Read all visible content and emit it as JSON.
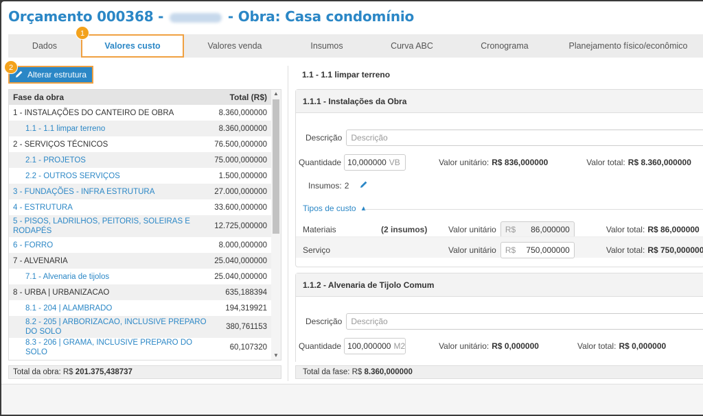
{
  "window": {
    "title_prefix": "Orçamento 000368 -",
    "title_suffix": "- Obra: Casa condomínio"
  },
  "tabs": [
    {
      "label": "Dados"
    },
    {
      "label": "Valores custo"
    },
    {
      "label": "Valores venda"
    },
    {
      "label": "Insumos"
    },
    {
      "label": "Curva ABC"
    },
    {
      "label": "Cronograma"
    },
    {
      "label": "Planejamento físico/econômico"
    }
  ],
  "badges": {
    "one": "1",
    "two": "2"
  },
  "left": {
    "alterar_label": "Alterar estrutura",
    "header": {
      "fase": "Fase da obra",
      "total": "Total (R$)"
    },
    "rows": [
      {
        "label": "1 - INSTALAÇÕES DO CANTEIRO DE OBRA",
        "value": "8.360,000000"
      },
      {
        "label": "1.1 - 1.1 limpar terreno",
        "value": "8.360,000000"
      },
      {
        "label": "2 - SERVIÇOS TÉCNICOS",
        "value": "76.500,000000"
      },
      {
        "label": "2.1 - PROJETOS",
        "value": "75.000,000000"
      },
      {
        "label": "2.2 - OUTROS SERVIÇOS",
        "value": "1.500,000000"
      },
      {
        "label": "3 - FUNDAÇÕES - INFRA ESTRUTURA",
        "value": "27.000,000000"
      },
      {
        "label": "4 - ESTRUTURA",
        "value": "33.600,000000"
      },
      {
        "label": "5 - PISOS, LADRILHOS, PEITORIS, SOLEIRAS E RODAPÉS",
        "value": "12.725,000000"
      },
      {
        "label": "6 - FORRO",
        "value": "8.000,000000"
      },
      {
        "label": "7 - ALVENARIA",
        "value": "25.040,000000"
      },
      {
        "label": "7.1 - Alvenaria de tijolos",
        "value": "25.040,000000"
      },
      {
        "label": "8 - URBA | URBANIZACAO",
        "value": "635,188394"
      },
      {
        "label": "8.1 - 204 | ALAMBRADO",
        "value": "194,319921"
      },
      {
        "label": "8.2 - 205 | ARBORIZACAO, INCLUSIVE PREPARO DO SOLO",
        "value": "380,761153"
      },
      {
        "label": "8.3 - 206 | GRAMA, INCLUSIVE PREPARO DO SOLO",
        "value": "60,107320"
      }
    ],
    "total_label": "Total da obra: R$",
    "total_value": "201.375,438737"
  },
  "right": {
    "crumb": "1.1 - 1.1 limpar terreno",
    "panel1": {
      "title": "1.1.1 - Instalações da Obra",
      "descricao_label": "Descrição",
      "descricao_placeholder": "Descrição",
      "quantidade_label": "Quantidade",
      "quantidade_value": "10,000000",
      "quantidade_unit": "VB",
      "valor_unitario_label": "Valor unitário:",
      "valor_unitario_value": "R$ 836,000000",
      "valor_total_label": "Valor total:",
      "valor_total_value": "R$ 8.360,000000",
      "insumos_label": "Insumos:",
      "insumos_count": "2",
      "tipos_label": "Tipos de custo",
      "materiais_label": "Materiais",
      "materiais_count": "(2 insumos)",
      "materiais_vu_label": "Valor unitário",
      "materiais_vu_prefix": "R$",
      "materiais_vu_value": "86,000000",
      "materiais_vt_label": "Valor total:",
      "materiais_vt_value": "R$ 86,000000",
      "servico_label": "Serviço",
      "servico_vu_label": "Valor unitário",
      "servico_vu_prefix": "R$",
      "servico_vu_value": "750,000000",
      "servico_vt_label": "Valor total:",
      "servico_vt_value": "R$ 750,000000"
    },
    "panel2": {
      "title": "1.1.2 - Alvenaria de Tijolo Comum",
      "descricao_label": "Descrição",
      "descricao_placeholder": "Descrição",
      "quantidade_label": "Quantidade",
      "quantidade_value": "100,000000",
      "quantidade_unit": "M2",
      "valor_unitario_label": "Valor unitário:",
      "valor_unitario_value": "R$ 0,000000",
      "valor_total_label": "Valor total:",
      "valor_total_value": "R$ 0,000000"
    },
    "total_label": "Total da fase: R$",
    "total_value": "8.360,000000"
  },
  "colors": {
    "accent": "#2b87c6",
    "highlight": "#f0a040",
    "badge": "#f3a21c"
  },
  "icons": {
    "edit": "pencil-icon",
    "collapse": "chevron-up-icon",
    "scroll_up": "arrow-up-icon",
    "scroll_down": "arrow-down-icon"
  }
}
